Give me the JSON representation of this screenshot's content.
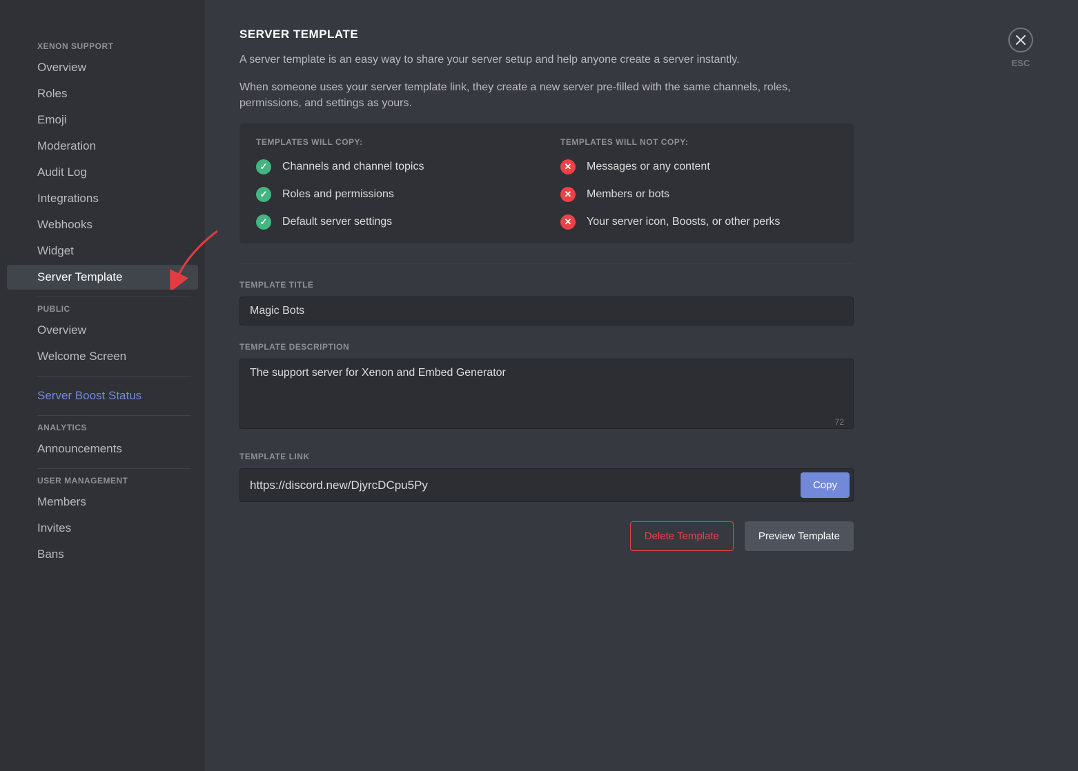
{
  "sidebar": {
    "sections": [
      {
        "header": "XENON SUPPORT",
        "items": [
          {
            "label": "Overview",
            "active": false
          },
          {
            "label": "Roles",
            "active": false
          },
          {
            "label": "Emoji",
            "active": false
          },
          {
            "label": "Moderation",
            "active": false
          },
          {
            "label": "Audit Log",
            "active": false
          },
          {
            "label": "Integrations",
            "active": false
          },
          {
            "label": "Webhooks",
            "active": false
          },
          {
            "label": "Widget",
            "active": false
          },
          {
            "label": "Server Template",
            "active": true
          }
        ]
      },
      {
        "header": "PUBLIC",
        "items": [
          {
            "label": "Overview",
            "active": false
          },
          {
            "label": "Welcome Screen",
            "active": false
          }
        ]
      },
      {
        "header": null,
        "items": [
          {
            "label": "Server Boost Status",
            "active": false,
            "boost": true
          }
        ]
      },
      {
        "header": "ANALYTICS",
        "items": [
          {
            "label": "Announcements",
            "active": false
          }
        ]
      },
      {
        "header": "USER MANAGEMENT",
        "items": [
          {
            "label": "Members",
            "active": false
          },
          {
            "label": "Invites",
            "active": false
          },
          {
            "label": "Bans",
            "active": false
          }
        ]
      }
    ]
  },
  "close": {
    "esc_label": "ESC"
  },
  "page": {
    "title": "SERVER TEMPLATE",
    "desc1": "A server template is an easy way to share your server setup and help anyone create a server instantly.",
    "desc2": "When someone uses your server template link, they create a new server pre-filled with the same channels, roles, permissions, and settings as yours."
  },
  "copy_lists": {
    "will_header": "TEMPLATES WILL COPY:",
    "will": [
      "Channels and channel topics",
      "Roles and permissions",
      "Default server settings"
    ],
    "wont_header": "TEMPLATES WILL NOT COPY:",
    "wont": [
      "Messages or any content",
      "Members or bots",
      "Your server icon, Boosts, or other perks"
    ]
  },
  "form": {
    "title_label": "TEMPLATE TITLE",
    "title_value": "Magic Bots",
    "desc_label": "TEMPLATE DESCRIPTION",
    "desc_value": "The support server for Xenon and Embed Generator",
    "desc_remaining": "72",
    "link_label": "TEMPLATE LINK",
    "link_value": "https://discord.new/DjyrcDCpu5Py",
    "copy_button": "Copy"
  },
  "actions": {
    "delete": "Delete Template",
    "preview": "Preview Template"
  }
}
